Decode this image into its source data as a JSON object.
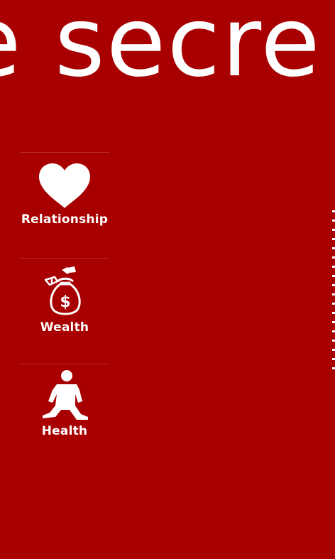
{
  "header": {
    "title": "e secre"
  },
  "menu": {
    "items": [
      {
        "id": "relationship",
        "label": "Relationship",
        "icon": "heart-icon"
      },
      {
        "id": "wealth",
        "label": "Wealth",
        "icon": "money-bag-icon"
      },
      {
        "id": "health",
        "label": "Health",
        "icon": "person-icon"
      }
    ]
  },
  "colors": {
    "background": "#a80000",
    "foreground": "#ffffff",
    "divider": "rgba(255,255,255,0.18)"
  }
}
